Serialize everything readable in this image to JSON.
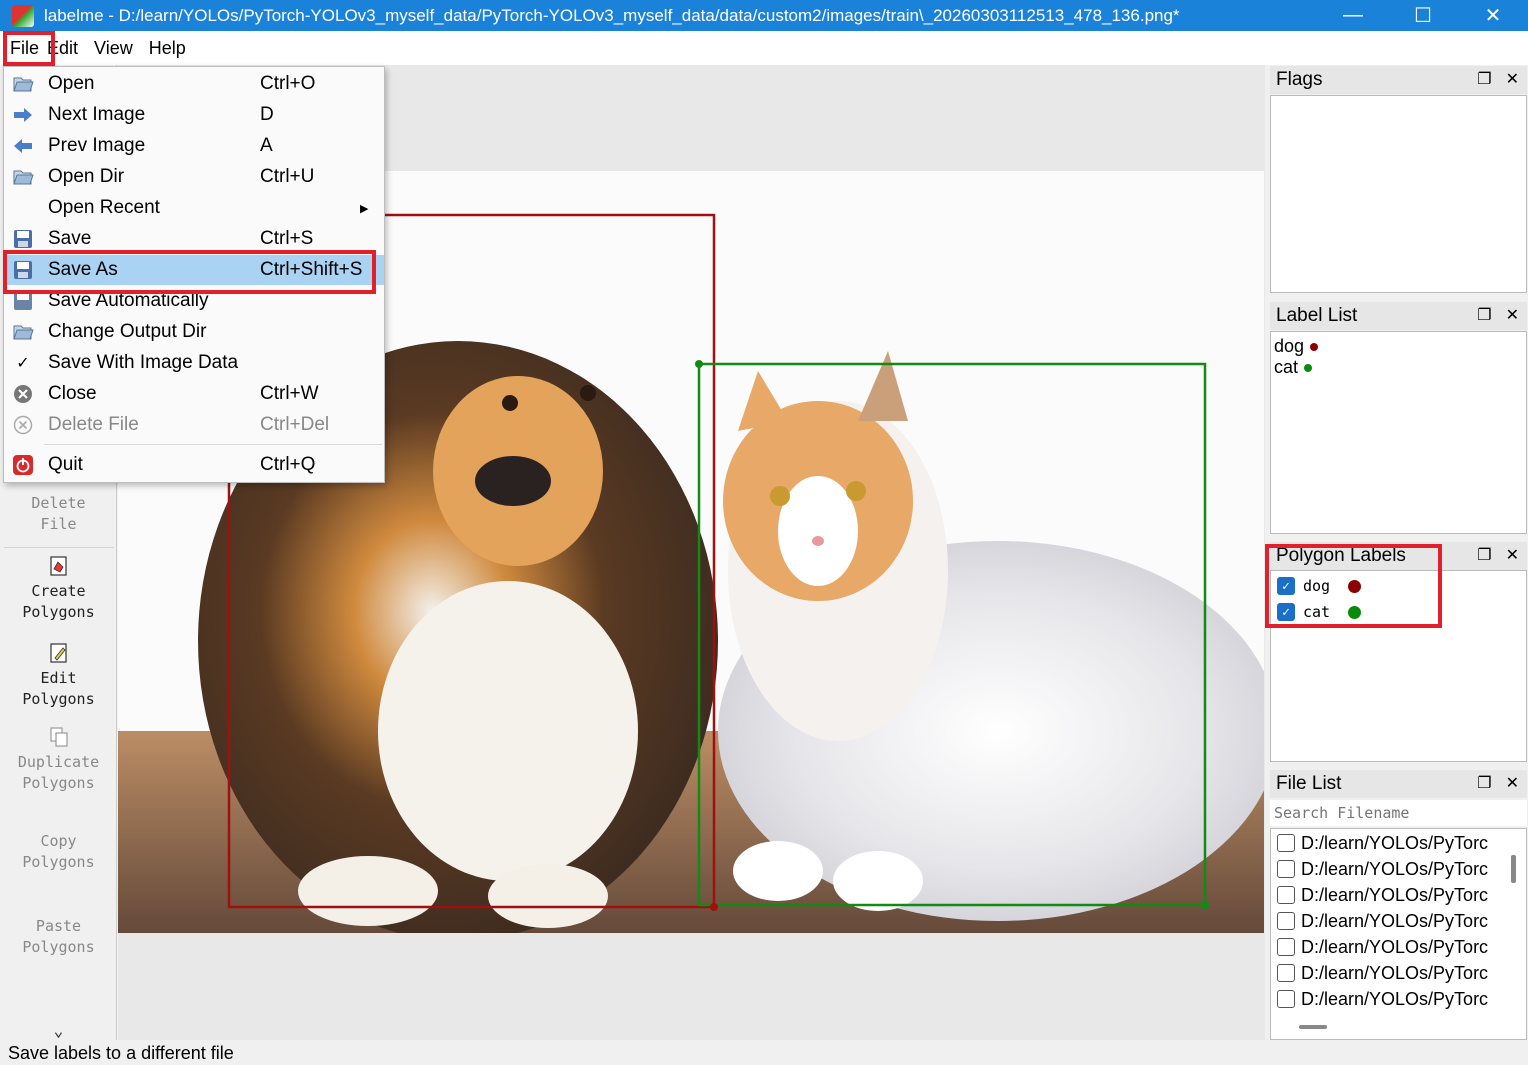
{
  "window": {
    "title": "labelme - D:/learn/YOLOs/PyTorch-YOLOv3_myself_data/PyTorch-YOLOv3_myself_data/data/custom2/images/train\\_20260303112513_478_136.png*",
    "minimize": "—",
    "maximize": "☐",
    "close": "✕"
  },
  "menubar": {
    "file": "File",
    "edit": "Edit",
    "view": "View",
    "help": "Help"
  },
  "file_menu": {
    "items": [
      {
        "label": "Open",
        "shortcut": "Ctrl+O"
      },
      {
        "label": "Next Image",
        "shortcut": "D"
      },
      {
        "label": "Prev Image",
        "shortcut": "A"
      },
      {
        "label": "Open Dir",
        "shortcut": "Ctrl+U"
      },
      {
        "label": "Open Recent",
        "shortcut": ""
      },
      {
        "label": "Save",
        "shortcut": "Ctrl+S"
      },
      {
        "label": "Save As",
        "shortcut": "Ctrl+Shift+S"
      },
      {
        "label": "Save Automatically",
        "shortcut": ""
      },
      {
        "label": "Change Output Dir",
        "shortcut": ""
      },
      {
        "label": "Save With Image Data",
        "shortcut": ""
      },
      {
        "label": "Close",
        "shortcut": "Ctrl+W"
      },
      {
        "label": "Delete File",
        "shortcut": "Ctrl+Del"
      },
      {
        "label": "Quit",
        "shortcut": "Ctrl+Q"
      }
    ]
  },
  "toolbar": {
    "delete_file": [
      "Delete",
      "File"
    ],
    "create_polygons": [
      "Create",
      "Polygons"
    ],
    "edit_polygons": [
      "Edit",
      "Polygons"
    ],
    "duplicate_polygons": [
      "Duplicate",
      "Polygons"
    ],
    "copy_polygons": [
      "Copy",
      "Polygons"
    ],
    "paste_polygons": [
      "Paste",
      "Polygons"
    ],
    "more": "⌄"
  },
  "docks": {
    "flags": {
      "title": "Flags"
    },
    "label_list": {
      "title": "Label List",
      "items": [
        {
          "label": "dog",
          "color": "#8b0000"
        },
        {
          "label": "cat",
          "color": "#0a8a0a"
        }
      ]
    },
    "polygon_labels": {
      "title": "Polygon Labels",
      "items": [
        {
          "label": "dog",
          "color": "#8b0000",
          "checked": true
        },
        {
          "label": "cat",
          "color": "#0a8a0a",
          "checked": true
        }
      ]
    },
    "file_list": {
      "title": "File List",
      "search_placeholder": "Search Filename",
      "items": [
        "D:/learn/YOLOs/PyTorc",
        "D:/learn/YOLOs/PyTorc",
        "D:/learn/YOLOs/PyTorc",
        "D:/learn/YOLOs/PyTorc",
        "D:/learn/YOLOs/PyTorc",
        "D:/learn/YOLOs/PyTorc",
        "D:/learn/YOLOs/PyTorc"
      ]
    }
  },
  "status": "Save labels to a different file",
  "colors": {
    "titlebar": "#1a82d8",
    "highlight": "#a9d2f3",
    "annotation_red": "#e0202a",
    "dog_box": "#a01010",
    "cat_box": "#138a13"
  }
}
